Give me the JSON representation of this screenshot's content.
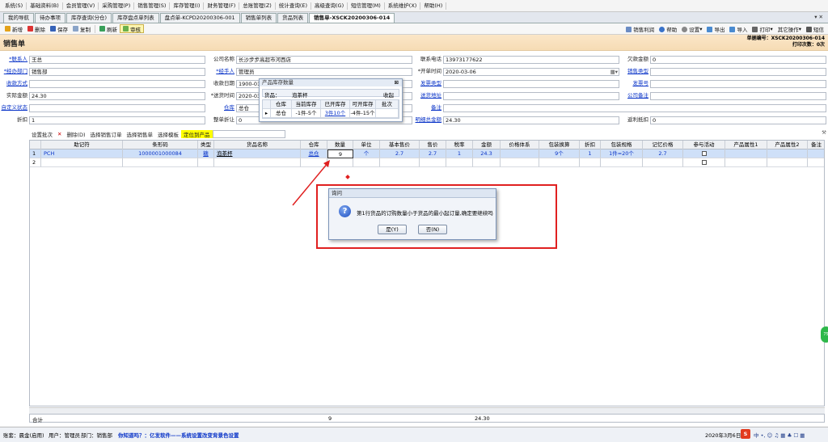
{
  "menu": [
    "系统(S)",
    "基础资料(B)",
    "会员管理(V)",
    "采购管理(P)",
    "销售管理(S)",
    "库存管理(I)",
    "财务管理(F)",
    "总账管理(Z)",
    "统计查询(E)",
    "高级查询(G)",
    "短信管理(M)",
    "系统维护(X)",
    "帮助(H)"
  ],
  "tabs": [
    "我的导航",
    "待办事项",
    "库存查询(分仓)",
    "库存盘点单列表",
    "盘点单-KCPD20200306-001",
    "销售单列表",
    "货品列表",
    "销售单-XSCK20200306-014"
  ],
  "tabs_active_index": 7,
  "toolbar": {
    "left": [
      "新增",
      "删除",
      "保存",
      "复制",
      "刷新",
      "审核"
    ],
    "right": [
      "销售利润",
      "帮助",
      "设置",
      "导出",
      "导入",
      "打印",
      "其它操作",
      "短信"
    ]
  },
  "title": "销售单",
  "doc_no_label": "单据编号：XSCK20200306-014",
  "print_count": "打印次数：0次",
  "form": {
    "contact_label": "*联系人",
    "contact": "王总",
    "company_label": "公司名称",
    "company": "长沙步步高超市河西店",
    "phone_label": "联系电话",
    "phone": "13973177622",
    "debt_label": "欠款金额",
    "debt": "0",
    "dept_label": "*经办部门",
    "dept": "销售部",
    "handler_label": "*经手人",
    "handler": "管理员",
    "invoice_date_label": "*开单时间",
    "invoice_date": "2020-03-06",
    "sale_type_label": "销售类型",
    "sale_type": "",
    "pay_method_label": "收款方式",
    "pay_method": "",
    "receive_date_label": "收款日期",
    "receive_date": "1900-01-0",
    "ship_type_label": "发票类型",
    "ship_type": "",
    "invoice_no_label": "发票号",
    "invoice_no": "",
    "actual_amount_label": "实际金额",
    "actual_amount": "24.30",
    "delivery_date_label": "*送货时间",
    "delivery_date": "2020-03-0",
    "ship_addr_label": "送货地址",
    "ship_addr": "",
    "company_note_label": "公司备注",
    "company_note": "",
    "custom_label": "自定义状态",
    "custom": "",
    "warehouse_label": "仓库",
    "warehouse": "总仓",
    "note_label": "备注",
    "note": "",
    "discount_label": "折扣",
    "discount": "1",
    "whole_discount_label": "整单折让",
    "whole_discount": "0",
    "detail_total_label": "明细总金额",
    "detail_total": "24.30",
    "credit_label": "返利抵扣",
    "credit": "0"
  },
  "grid_toolbar": {
    "settings": "设置批次",
    "delete": "删除(D)",
    "pick_order": "选择销售订单",
    "pick_sale": "选择销售单",
    "pick_template": "选择模板",
    "locate": "定位到产品"
  },
  "grid": {
    "headers": [
      "助记符",
      "条形码",
      "类型",
      "货品名称",
      "仓库",
      "数量",
      "单位",
      "基本售价",
      "售价",
      "税率",
      "金额",
      "价格体系",
      "包装换算",
      "折扣",
      "包装规格",
      "记忆价格",
      "参与活动",
      "产品属性1",
      "产品属性2",
      "备注"
    ],
    "rows": [
      {
        "no": "1",
        "code": "PCH",
        "barcode": "1000001000084",
        "type": "糖",
        "name": "泡茶杯",
        "warehouse": "总仓",
        "qty": "9",
        "unit": "个",
        "base_price": "2.7",
        "price": "2.7",
        "tax": "1",
        "amount": "24.3",
        "price_sys": "",
        "pack_conv": "9个",
        "discount": "1",
        "pack_spec": "1件=20个",
        "memo_price": "2.7"
      },
      {
        "no": "2",
        "code": "",
        "barcode": "",
        "type": "",
        "name": "",
        "warehouse": "",
        "qty": "",
        "unit": "",
        "base_price": "",
        "price": "",
        "tax": "",
        "amount": "",
        "price_sys": "",
        "pack_conv": "",
        "discount": "",
        "pack_spec": "",
        "memo_price": ""
      }
    ],
    "sum_label": "合计",
    "sum_qty": "9",
    "sum_amount": "24.30"
  },
  "stock_popup": {
    "title": "产品库存数量",
    "product_label": "货品：",
    "product": "泡茶杯",
    "collapse": "收起",
    "headers": [
      "仓库",
      "当前库存",
      "已开库存",
      "可开库存",
      "批次"
    ],
    "row": {
      "warehouse": "总仓",
      "current": "-1件-5个",
      "opened": "3件10个",
      "available": "-4件-15个",
      "batch": ""
    }
  },
  "dialog": {
    "title": "询问",
    "message": "第1行货品的订购数量小于货品的最小起订量,确定要继续吗",
    "yes": "是(Y)",
    "no": "否(N)"
  },
  "status": {
    "db": "账套：晨金(启用)",
    "user": "用户：管理员",
    "dept": "部门：销售部",
    "ad": "你知道吗？：亿发软件——系统设置改变背景色设置",
    "date": "2020年3月6日"
  },
  "green_badge": "75"
}
